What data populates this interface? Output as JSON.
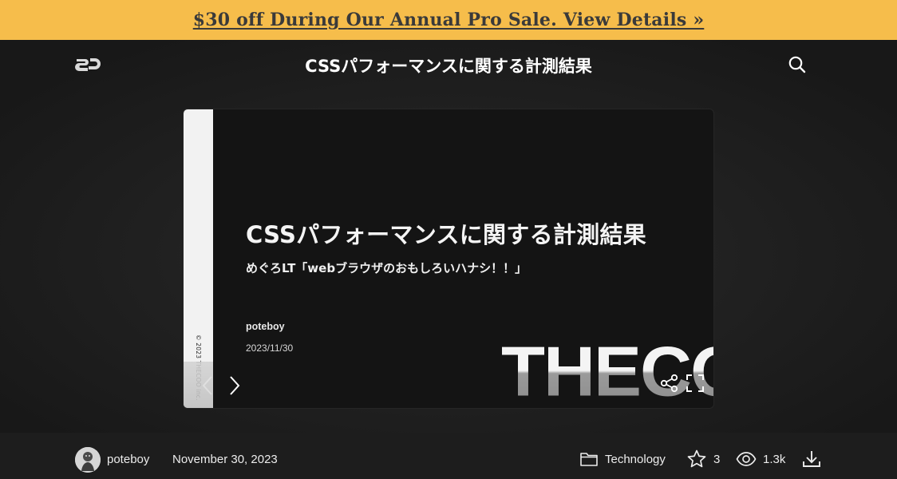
{
  "promo": {
    "text": "$30 off During Our Annual Pro Sale. View Details »"
  },
  "header": {
    "logo_text": "SD",
    "title": "CSSパフォーマンスに関する計測結果"
  },
  "slide": {
    "side_copyright": "© 2023 THECOO inc.",
    "title": "CSSパフォーマンスに関する計測結果",
    "subtitle": "めぐろLT「webブラウザのおもしろいハナシ！！」",
    "author": "poteboy",
    "date": "2023/11/30",
    "brand": "THECOO"
  },
  "meta": {
    "author": "poteboy",
    "published": "November 30, 2023",
    "category": "Technology",
    "stars": "3",
    "views": "1.3k"
  },
  "colors": {
    "promo_bg": "#f6bd4b",
    "page_bg": "#1c1c1c",
    "slide_bg": "#141414"
  },
  "icons": [
    "speakerdeck-logo",
    "search-icon",
    "chevron-left-icon",
    "chevron-right-icon",
    "share-icon",
    "fullscreen-icon",
    "folder-icon",
    "star-icon",
    "eye-icon",
    "download-icon"
  ]
}
